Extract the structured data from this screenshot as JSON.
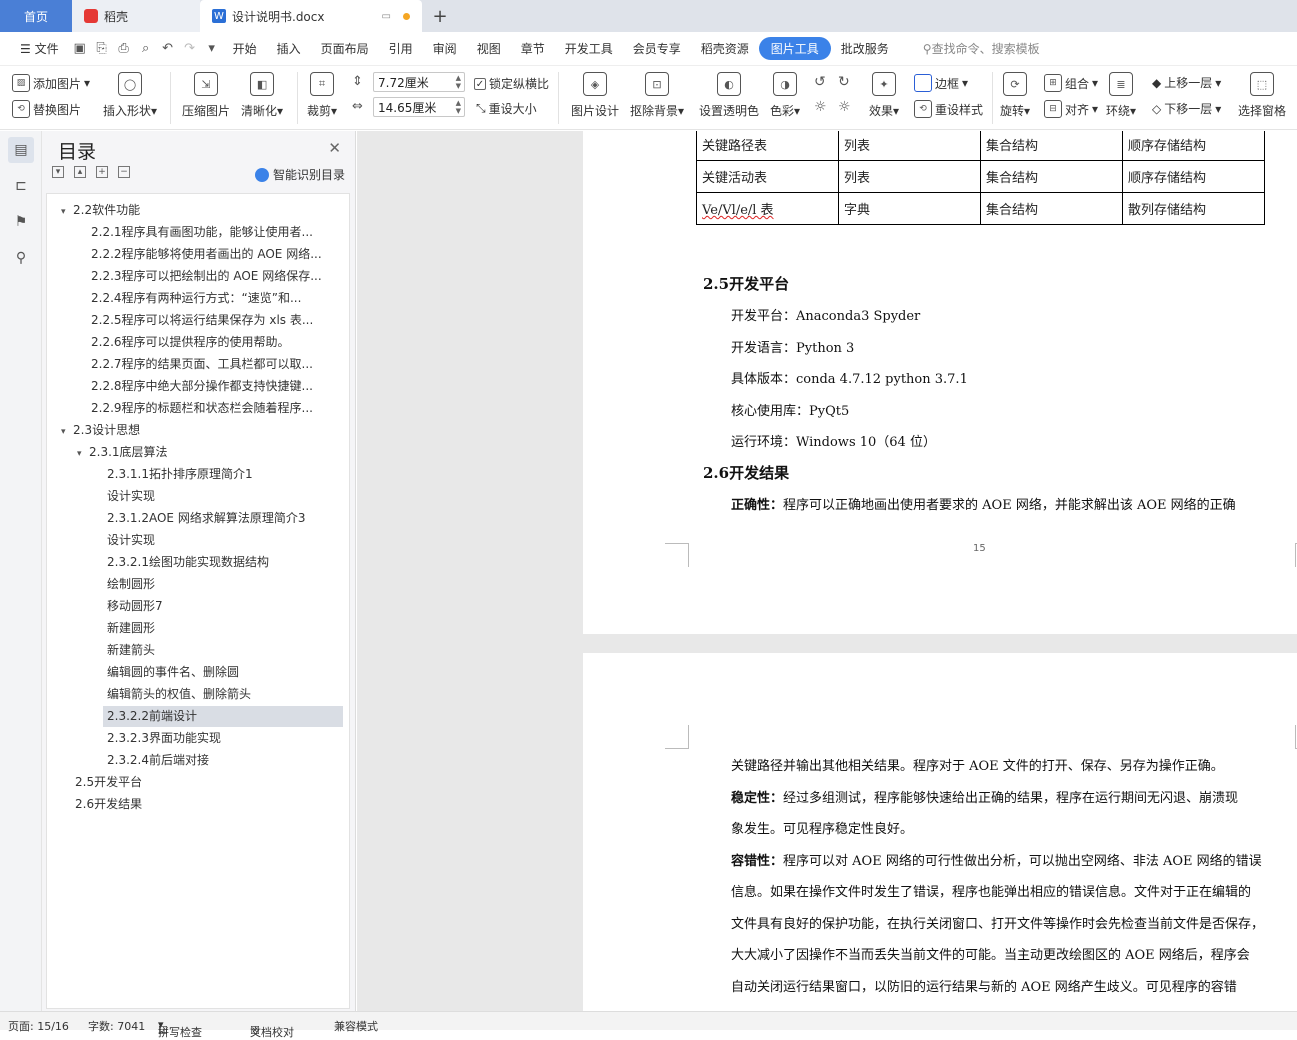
{
  "tabs": {
    "home": "首页",
    "shell": "稻壳",
    "doc": "设计说明书.docx",
    "new": "+"
  },
  "menu": {
    "file": "文件",
    "items": [
      "开始",
      "插入",
      "页面布局",
      "引用",
      "审阅",
      "视图",
      "章节",
      "开发工具",
      "会员专享",
      "稻壳资源"
    ],
    "active": "图片工具",
    "after": "批改服务",
    "search": "查找命令、搜索模板"
  },
  "toolbar": {
    "add_image": "添加图片",
    "replace_image": "替换图片",
    "insert_shape": "插入形状",
    "compress": "压缩图片",
    "clarify": "清晰化",
    "crop": "裁剪",
    "width": "7.72厘米",
    "height": "14.65厘米",
    "lock_ratio": "锁定纵横比",
    "resize": "重设大小",
    "image_design": "图片设计",
    "remove_bg": "抠除背景",
    "transparent": "设置透明色",
    "color": "色彩",
    "effect": "效果",
    "border": "边框",
    "reset_style": "重设样式",
    "rotate": "旋转",
    "group": "组合",
    "align": "对齐",
    "wrap": "环绕",
    "up": "上移一层",
    "down": "下移一层",
    "select_pane": "选择窗格"
  },
  "toc": {
    "title": "目录",
    "smart": "智能识别目录",
    "items": [
      {
        "label": "2.2软件功能",
        "level": 1,
        "toggle": "open"
      },
      {
        "label": "2.2.1程序具有画图功能，能够让使用者...",
        "level": 2
      },
      {
        "label": "2.2.2程序能够将使用者画出的 AOE 网络...",
        "level": 2
      },
      {
        "label": "2.2.3程序可以把绘制出的 AOE 网络保存...",
        "level": 2
      },
      {
        "label": "2.2.4程序有两种运行方式：“速览”和...",
        "level": 2
      },
      {
        "label": "2.2.5程序可以将运行结果保存为 xls 表...",
        "level": 2
      },
      {
        "label": "2.2.6程序可以提供程序的使用帮助。",
        "level": 2
      },
      {
        "label": "2.2.7程序的结果页面、工具栏都可以取...",
        "level": 2
      },
      {
        "label": "2.2.8程序中绝大部分操作都支持快捷键...",
        "level": 2
      },
      {
        "label": "2.2.9程序的标题栏和状态栏会随着程序...",
        "level": 2
      },
      {
        "label": "2.3设计思想",
        "level": 1,
        "toggle": "open"
      },
      {
        "label": "2.3.1底层算法",
        "level": 2,
        "toggle": "open"
      },
      {
        "label": "2.3.1.1拓扑排序原理简介1",
        "level": 3
      },
      {
        "label": "设计实现",
        "level": 3
      },
      {
        "label": "2.3.1.2AOE 网络求解算法原理简介3",
        "level": 3
      },
      {
        "label": "设计实现",
        "level": 3
      },
      {
        "label": "2.3.2.1绘图功能实现数据结构",
        "level": 3
      },
      {
        "label": "绘制圆形",
        "level": 3
      },
      {
        "label": "移动圆形7",
        "level": 3
      },
      {
        "label": "新建圆形",
        "level": 3
      },
      {
        "label": "新建箭头",
        "level": 3
      },
      {
        "label": "编辑圆的事件名、删除圆",
        "level": 3
      },
      {
        "label": "编辑箭头的权值、删除箭头",
        "level": 3
      },
      {
        "label": "2.3.2.2前端设计",
        "level": 3,
        "selected": true
      },
      {
        "label": "2.3.2.3界面功能实现",
        "level": 3
      },
      {
        "label": "2.3.2.4前后端对接",
        "level": 3
      },
      {
        "label": "2.5开发平台",
        "level": 1
      },
      {
        "label": "2.6开发结果",
        "level": 1
      }
    ]
  },
  "doc": {
    "table": [
      [
        "关键路径表",
        "列表",
        "集合结构",
        "顺序存储结构"
      ],
      [
        "关键活动表",
        "列表",
        "集合结构",
        "顺序存储结构"
      ],
      [
        "Ve/Vl/e/l 表",
        "字典",
        "集合结构",
        "散列存储结构"
      ]
    ],
    "h25": "2.5开发平台",
    "p1": "开发平台：Anaconda3 Spyder",
    "p2": "开发语言：Python 3",
    "p3": "具体版本：conda 4.7.12 python 3.7.1",
    "p4": "核心使用库：PyQt5",
    "p5": "运行环境：Windows 10（64 位）",
    "h26": "2.6开发结果",
    "correct_label": "正确性：",
    "correct_text": "程序可以正确地画出使用者要求的 AOE 网络，并能求解出该 AOE 网络的正确",
    "page_num": "15",
    "p2_1": "关键路径并输出其他相关结果。程序对于 AOE 文件的打开、保存、另存为操作正确。",
    "stable_label": "稳定性：",
    "stable_text": "经过多组测试，程序能够快速给出正确的结果，程序在运行期间无闪退、崩溃现",
    "p2_3": "象发生。可见程序稳定性良好。",
    "tol_label": "容错性：",
    "tol_text": "程序可以对 AOE 网络的可行性做出分析，可以抛出空网络、非法 AOE 网络的错误",
    "p2_5": "信息。如果在操作文件时发生了错误，程序也能弹出相应的错误信息。文件对于正在编辑的",
    "p2_6": "文件具有良好的保护功能，在执行关闭窗口、打开文件等操作时会先检查当前文件是否保存，",
    "p2_7": "大大减小了因操作不当而丢失当前文件的可能。当主动更改绘图区的 AOE 网络后，程序会",
    "p2_8": "自动关闭运行结果窗口，以防旧的运行结果与新的 AOE 网络产生歧义。可见程序的容错"
  },
  "status": {
    "page": "页面: 15/16",
    "words": "字数: 7041",
    "spell": "拼写检查",
    "proof": "文档校对",
    "compat": "兼容模式"
  }
}
